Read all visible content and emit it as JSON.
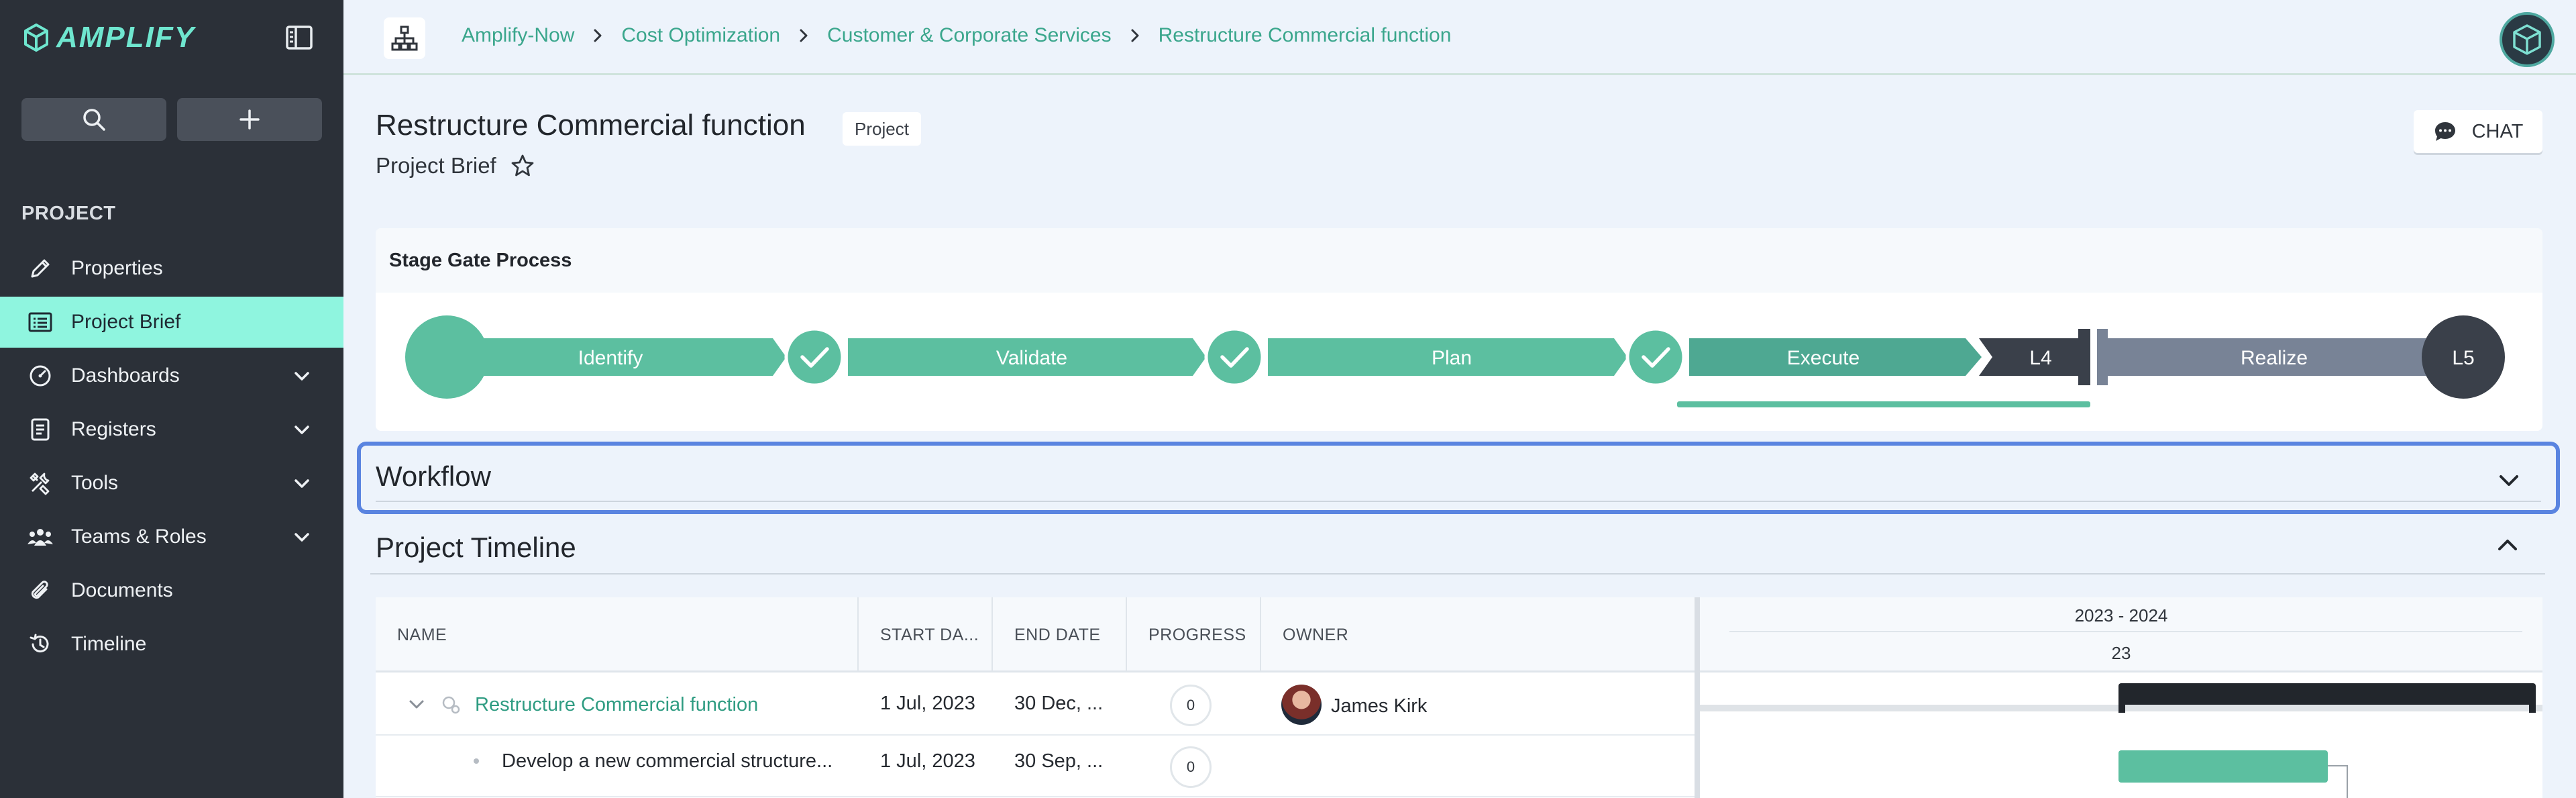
{
  "app": {
    "name": "AMPLIFY"
  },
  "sidebar": {
    "section_label": "PROJECT",
    "items": [
      {
        "label": "Properties",
        "icon": "pencil-icon",
        "active": false,
        "expandable": false
      },
      {
        "label": "Project Brief",
        "icon": "brief-icon",
        "active": true,
        "expandable": false
      },
      {
        "label": "Dashboards",
        "icon": "dashboard-icon",
        "active": false,
        "expandable": true
      },
      {
        "label": "Registers",
        "icon": "register-icon",
        "active": false,
        "expandable": true
      },
      {
        "label": "Tools",
        "icon": "tools-icon",
        "active": false,
        "expandable": true
      },
      {
        "label": "Teams & Roles",
        "icon": "teams-icon",
        "active": false,
        "expandable": true
      },
      {
        "label": "Documents",
        "icon": "paperclip-icon",
        "active": false,
        "expandable": false
      },
      {
        "label": "Timeline",
        "icon": "history-icon",
        "active": false,
        "expandable": false
      }
    ]
  },
  "breadcrumb": [
    "Amplify-Now",
    "Cost Optimization",
    "Customer & Corporate Services",
    "Restructure Commercial function"
  ],
  "header": {
    "title": "Restructure Commercial function",
    "type_badge": "Project",
    "subtitle": "Project Brief",
    "chat_label": "CHAT"
  },
  "stage_gate": {
    "title": "Stage Gate Process",
    "stages": [
      "Identify",
      "Validate",
      "Plan",
      "Execute",
      "Realize"
    ],
    "gates": [
      "L4",
      "L5"
    ]
  },
  "workflow": {
    "title": "Workflow"
  },
  "timeline": {
    "title": "Project Timeline",
    "columns": [
      "NAME",
      "START DA...",
      "END DATE",
      "PROGRESS",
      "OWNER"
    ],
    "rows": [
      {
        "name": "Restructure Commercial function",
        "start": "1 Jul, 2023",
        "end": "30 Dec, ...",
        "progress": "0",
        "owner": "James Kirk"
      },
      {
        "name": "Develop a new commercial structure...",
        "start": "1 Jul, 2023",
        "end": "30 Sep, ...",
        "progress": "0",
        "owner": ""
      }
    ],
    "gantt": {
      "year_range": "2023 - 2024",
      "period": "23"
    }
  },
  "colors": {
    "accent": "#5cbfa0",
    "sidebar_bg": "#2b3038",
    "active_nav": "#8ff5df",
    "dark_gate": "#3a404a",
    "realize": "#788396",
    "focus": "#5a84e0"
  }
}
